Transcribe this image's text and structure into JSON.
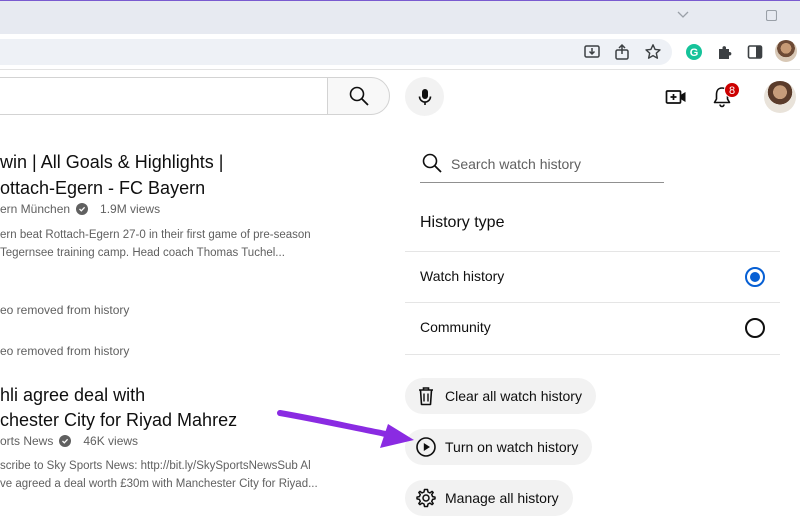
{
  "browser": {
    "window_controls": [
      "minimize-chevron",
      "maximize"
    ],
    "toolbar_icons": [
      "install-app-icon",
      "share-icon",
      "bookmark-star-icon",
      "grammarly-icon",
      "extensions-puzzle-icon",
      "side-panel-icon"
    ]
  },
  "youtube_header": {
    "search_query": "",
    "notification_count": "8",
    "icons": [
      "search-icon",
      "microphone-icon",
      "create-video-icon",
      "bell-icon"
    ]
  },
  "feed": {
    "video1": {
      "title_line1": "win | All Goals & Highlights |",
      "title_line2": "ottach-Egern - FC Bayern",
      "channel": "ern München",
      "views": "1.9M views",
      "desc_line1": "ern beat Rottach-Egern 27-0 in their first game of pre-season",
      "desc_line2": "Tegernsee training camp. Head coach Thomas Tuchel..."
    },
    "removed1": "eo removed from history",
    "removed2": "eo removed from history",
    "video2": {
      "title_line1": "hli agree deal with",
      "title_line2": "chester City for Riyad Mahrez",
      "channel": "orts News",
      "views": "46K views",
      "desc_line1": "scribe to Sky Sports News: http://bit.ly/SkySportsNewsSub Al",
      "desc_line2": "ve agreed a deal worth £30m with Manchester City for Riyad..."
    }
  },
  "history_panel": {
    "search_placeholder": "Search watch history",
    "history_type_heading": "History type",
    "options": [
      {
        "label": "Watch history",
        "selected": true
      },
      {
        "label": "Community",
        "selected": false
      }
    ],
    "actions": {
      "clear": "Clear all watch history",
      "turn_on": "Turn on watch history",
      "manage": "Manage all history"
    }
  },
  "colors": {
    "accent_blue": "#065fd4",
    "annotation_arrow": "#8a2be2",
    "badge_red": "#cc0000"
  }
}
